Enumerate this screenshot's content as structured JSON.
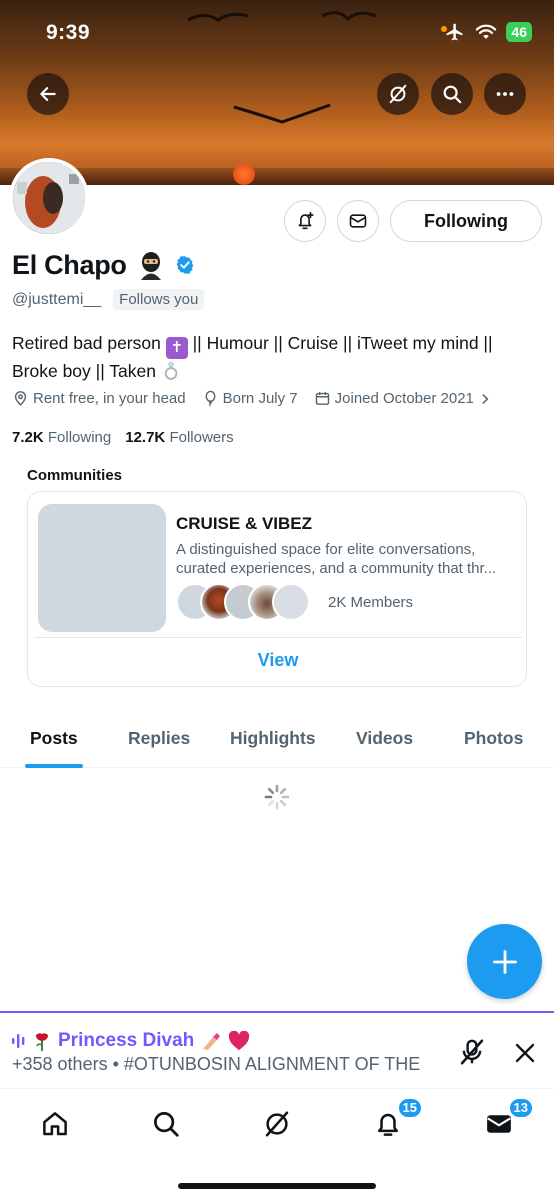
{
  "status_bar": {
    "time": "9:39",
    "battery": "46"
  },
  "profile": {
    "name": "El Chapo",
    "handle": "@justtemi__",
    "follows_you": "Follows you",
    "following_button": "Following",
    "bio_part1": "Retired bad person",
    "bio_part2": "|| Humour || Cruise || iTweet my mind ||",
    "bio_part3": "Broke boy || Taken",
    "location": "Rent free, in your head",
    "birthday": "Born July 7",
    "joined": "Joined October 2021",
    "following_count": "7.2K",
    "following_label": "Following",
    "followers_count": "12.7K",
    "followers_label": "Followers"
  },
  "communities": {
    "title": "Communities",
    "name": "CRUISE & VIBEZ",
    "desc_line1": "A distinguished space for elite conversations,",
    "desc_line2": "curated experiences, and a community that thr...",
    "members": "2K Members",
    "view": "View"
  },
  "tabs": [
    "Posts",
    "Replies",
    "Highlights",
    "Videos",
    "Photos"
  ],
  "space": {
    "host": "Princess Divah",
    "subtitle": "+358 others • #OTUNBOSIN ALIGNMENT OF THE"
  },
  "nav": {
    "notifications_badge": "15",
    "messages_badge": "13"
  },
  "colors": {
    "accent": "#1d9bf0",
    "spaces": "#7856ff",
    "verified": "#1d9bf0"
  }
}
